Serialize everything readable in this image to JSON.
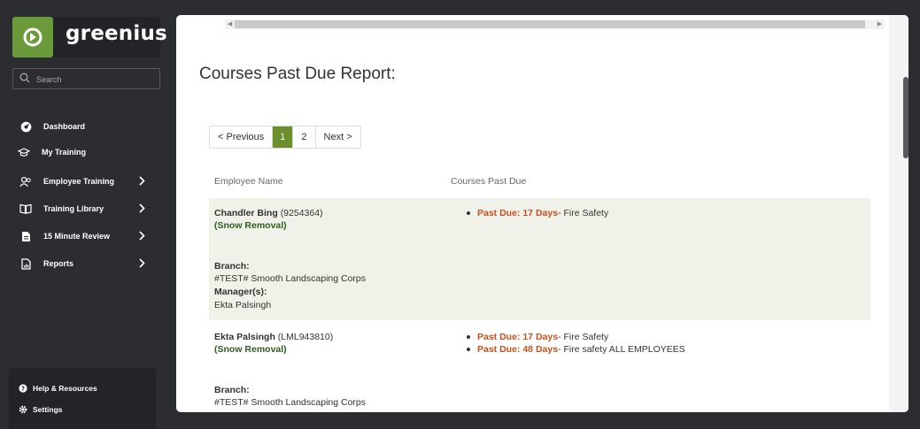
{
  "brand": {
    "name": "greenius"
  },
  "search": {
    "placeholder": "Search"
  },
  "nav": [
    {
      "label": "Dashboard",
      "icon": "dashboard-icon"
    },
    {
      "label": "My Training",
      "icon": "graduation-cap-icon"
    },
    {
      "label": "Employee Training",
      "icon": "users-icon"
    },
    {
      "label": "Training Library",
      "icon": "book-icon"
    },
    {
      "label": "15 Minute Review",
      "icon": "document-icon"
    },
    {
      "label": "Reports",
      "icon": "report-icon"
    }
  ],
  "bottom": [
    {
      "label": "Help & Resources",
      "icon": "help-icon"
    },
    {
      "label": "Settings",
      "icon": "gear-icon"
    }
  ],
  "report": {
    "title": "Courses Past Due Report:",
    "pager": {
      "prev": "< Previous",
      "pages": [
        "1",
        "2"
      ],
      "active": "1",
      "next": "Next >"
    },
    "columns": {
      "employee": "Employee Name",
      "courses": "Courses Past Due"
    },
    "rows": [
      {
        "name": "Chandler Bing",
        "id": "(9254364)",
        "dept": "(Snow Removal)",
        "branch_label": "Branch:",
        "branch": "#TEST# Smooth Landscaping Corps",
        "manager_label": "Manager(s):",
        "manager": "Ekta Palsingh",
        "past_due": [
          {
            "due": "Past Due: 17 Days",
            "course": " - Fire Safety"
          }
        ]
      },
      {
        "name": "Ekta Palsingh",
        "id": "(LML943810)",
        "dept": "(Snow Removal)",
        "branch_label": "Branch:",
        "branch": "#TEST# Smooth Landscaping Corps",
        "past_due": [
          {
            "due": "Past Due: 17 Days",
            "course": " - Fire Safety"
          },
          {
            "due": "Past Due: 48 Days",
            "course": " - Fire safety ALL EMPLOYEES"
          }
        ]
      }
    ]
  },
  "colors": {
    "accent": "#6b8f2a",
    "logo": "#6b9a3a",
    "past_due": "#c8501e",
    "dept": "#2f5c1f"
  }
}
